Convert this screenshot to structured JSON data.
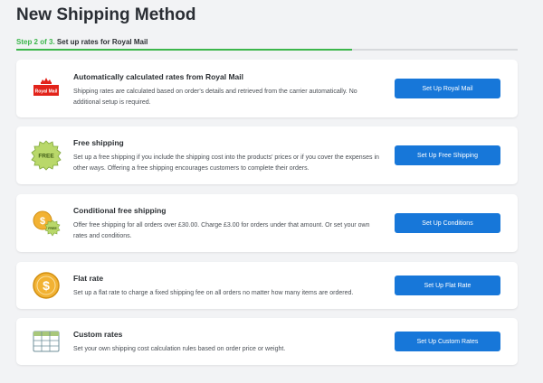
{
  "header": {
    "title": "New Shipping Method",
    "step_number": "Step 2 of 3.",
    "step_text": "Set up rates for Royal Mail",
    "progress": 0.67
  },
  "cards": [
    {
      "icon": "royal-mail-logo-icon",
      "logo_text": "Royal Mail",
      "title": "Automatically calculated rates from Royal Mail",
      "desc": "Shipping rates are calculated based on order's details and retrieved from the carrier automatically. No additional setup is required.",
      "button": "Set Up Royal Mail"
    },
    {
      "icon": "free-badge-icon",
      "badge_text": "FREE",
      "title": "Free shipping",
      "desc": "Set up a free shipping if you include the shipping cost into the products' prices or if you cover the expenses in other ways. Offering a free shipping encourages customers to complete their orders.",
      "button": "Set Up Free Shipping"
    },
    {
      "icon": "conditional-coins-icon",
      "badge_text": "FREE",
      "title": "Conditional free shipping",
      "desc": "Offer free shipping for all orders over £30.00. Charge £3.00 for orders under that amount. Or set your own rates and conditions.",
      "button": "Set Up Conditions"
    },
    {
      "icon": "dollar-coin-icon",
      "title": "Flat rate",
      "desc": "Set up a flat rate to charge a fixed shipping fee on all orders no matter how many items are ordered.",
      "button": "Set Up Flat Rate"
    },
    {
      "icon": "table-grid-icon",
      "title": "Custom rates",
      "desc": "Set your own shipping cost calculation rules based on order price or weight.",
      "button": "Set Up Custom Rates"
    }
  ],
  "colors": {
    "accent": "#1777d9",
    "progress": "#3cb64b"
  }
}
